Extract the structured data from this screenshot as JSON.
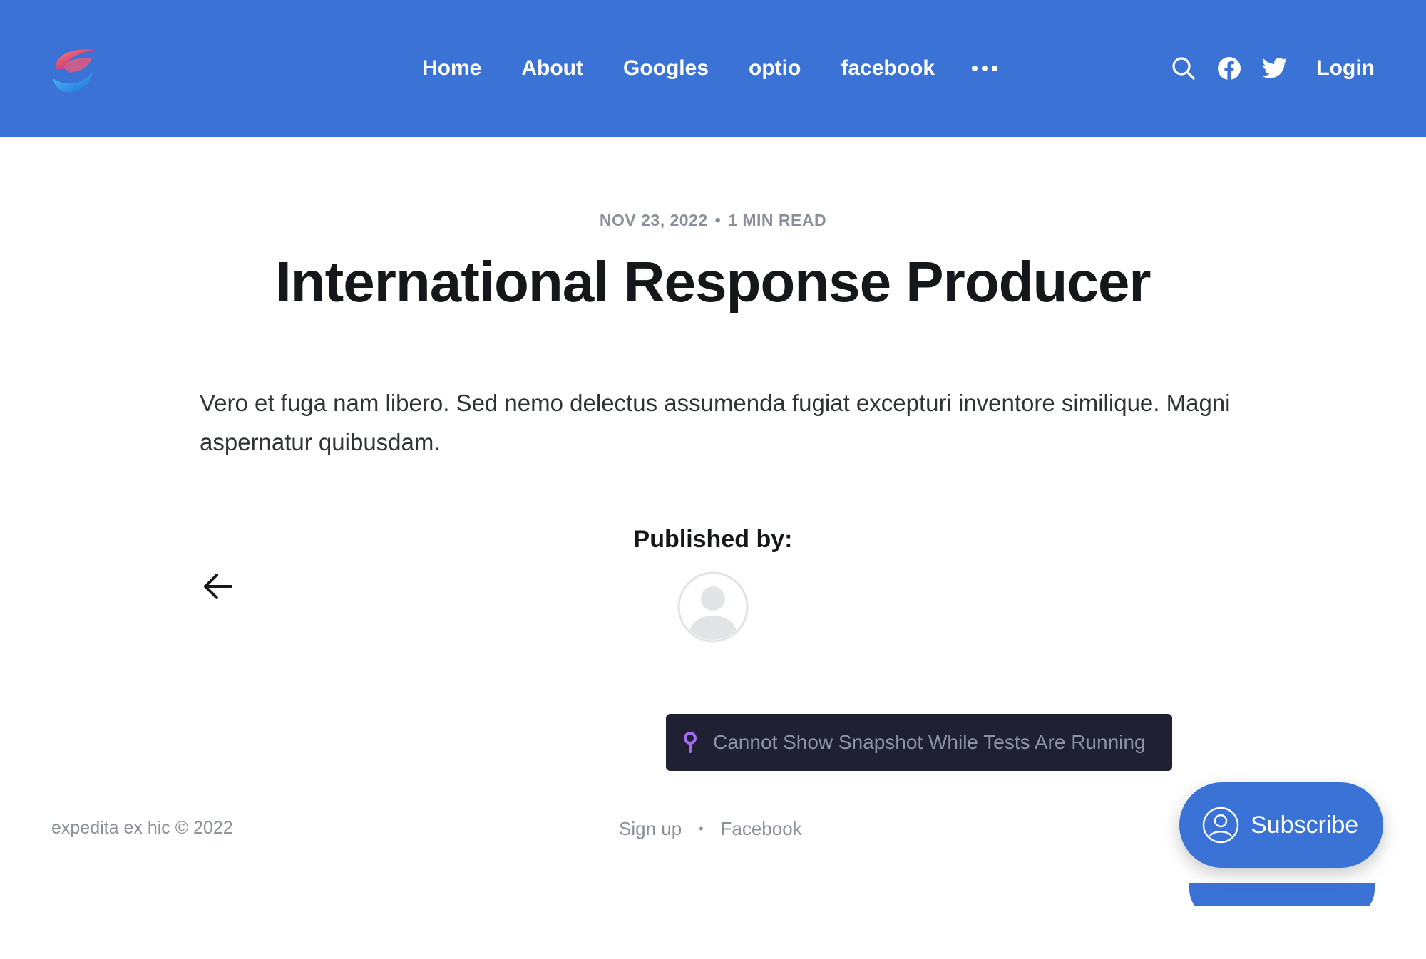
{
  "header": {
    "bg_color": "#3b72d6",
    "logo_icon": "brand-swirl-logo",
    "nav": [
      "Home",
      "About",
      "Googles",
      "optio",
      "facebook"
    ],
    "more_icon": "more-dots-icon",
    "search_icon": "search-icon",
    "facebook_icon": "facebook-icon",
    "twitter_icon": "twitter-icon",
    "login_label": "Login"
  },
  "post": {
    "date": "NOV 23, 2022",
    "reading_time": "1 MIN READ",
    "separator": "•",
    "title": "International Response Producer",
    "body": "Vero et fuga nam libero. Sed nemo delectus assumenda fugiat excepturi inventore similique. Magni aspernatur quibusdam.",
    "published_by_label": "Published by:",
    "back_icon": "arrow-left-icon",
    "avatar_icon": "default-avatar-icon"
  },
  "toast": {
    "icon": "pin-icon",
    "text": "Cannot Show Snapshot While Tests Are Running",
    "bg_color": "#1f2133"
  },
  "footer": {
    "copyright": "expedita ex hic © 2022",
    "links": [
      "Sign up",
      "Facebook"
    ],
    "separator": "•"
  },
  "subscribe": {
    "label": "Subscribe",
    "icon": "user-circle-icon"
  }
}
